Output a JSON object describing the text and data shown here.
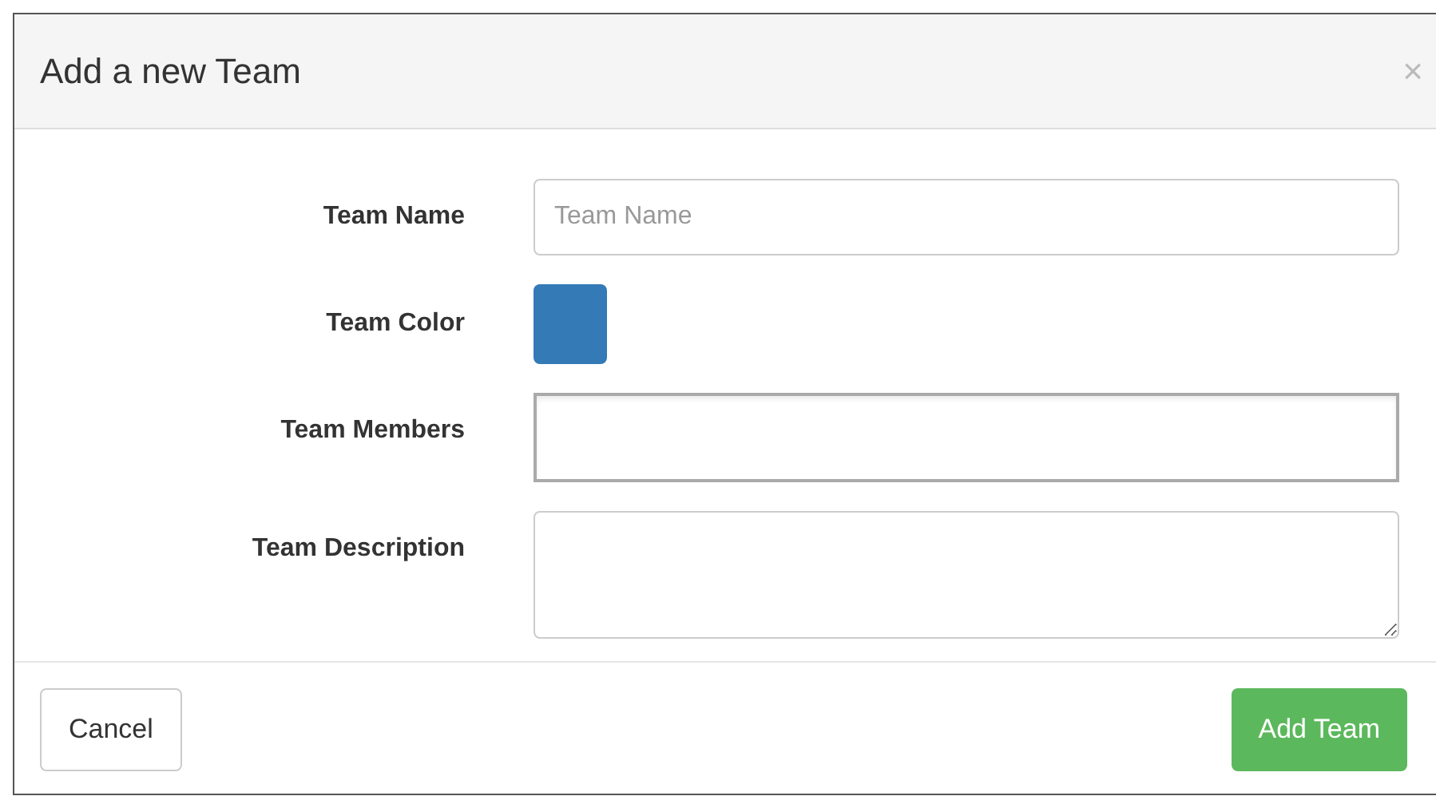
{
  "dialog": {
    "title": "Add a new Team",
    "close": "×"
  },
  "fields": [
    {
      "kind": "text",
      "label": "Team Name",
      "placeholder": "Team Name"
    },
    {
      "kind": "color",
      "label": "Team Color",
      "color": "#337ab7"
    },
    {
      "kind": "members",
      "label": "Team Members"
    },
    {
      "kind": "textarea",
      "label": "Team Description"
    }
  ],
  "buttons": [
    {
      "label": "Cancel",
      "kind": "default"
    },
    {
      "label": "Add Team",
      "kind": "primary"
    }
  ]
}
